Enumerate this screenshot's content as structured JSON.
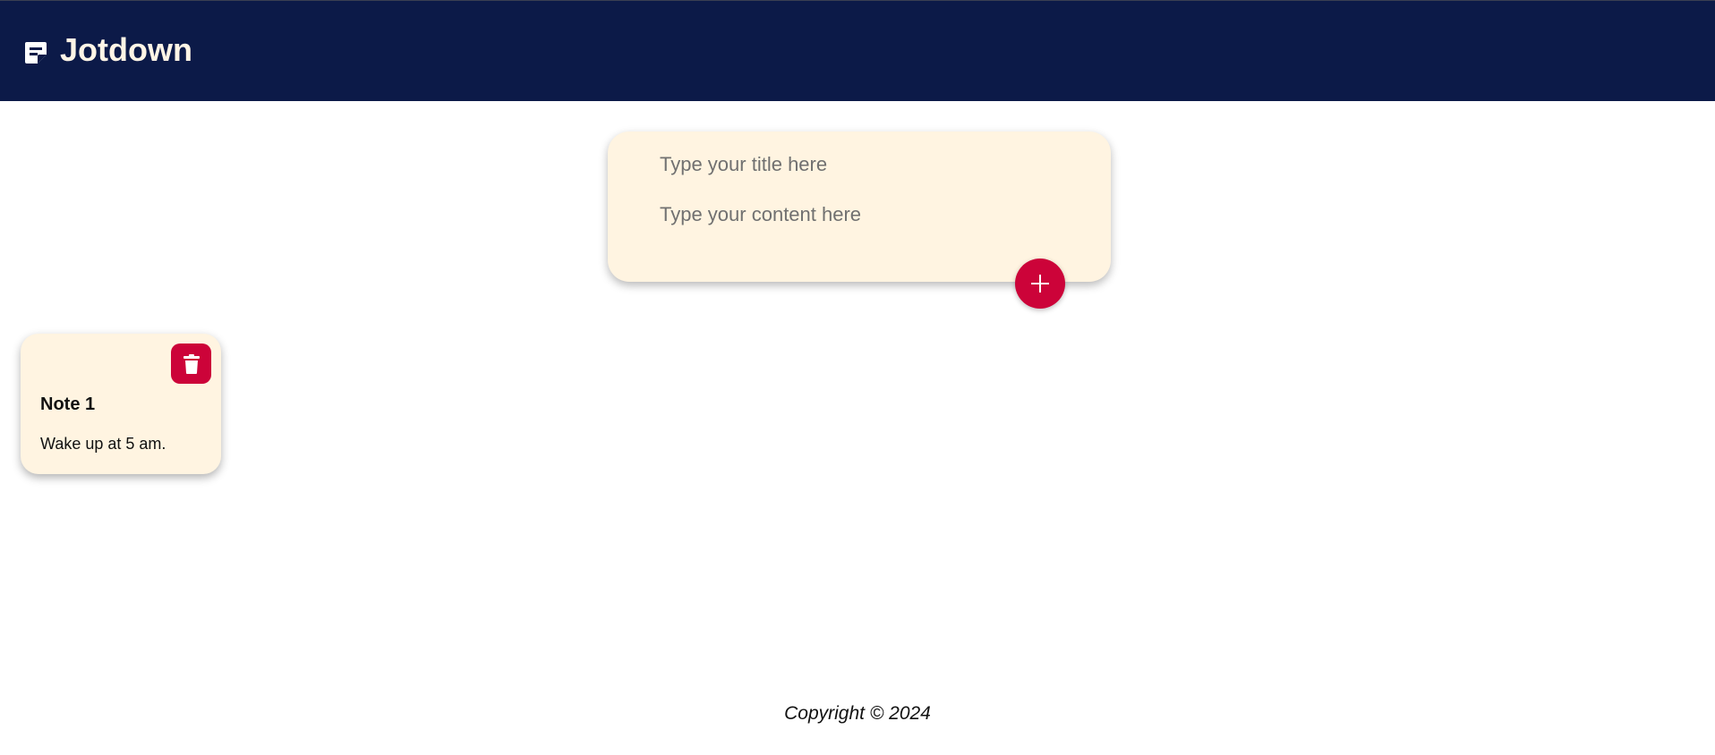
{
  "header": {
    "title": "Jotdown",
    "icon": "note-icon",
    "background_color": "#0c1a48",
    "title_color": "#fff5e6"
  },
  "create_note": {
    "title_placeholder": "Type your title here",
    "content_placeholder": "Type your content here",
    "add_icon": "plus-icon",
    "accent_color": "#cc0339"
  },
  "notes": [
    {
      "title": "Note 1",
      "content": "Wake up at 5 am.",
      "delete_icon": "trash-icon"
    }
  ],
  "footer": {
    "text": "Copyright © 2024"
  }
}
